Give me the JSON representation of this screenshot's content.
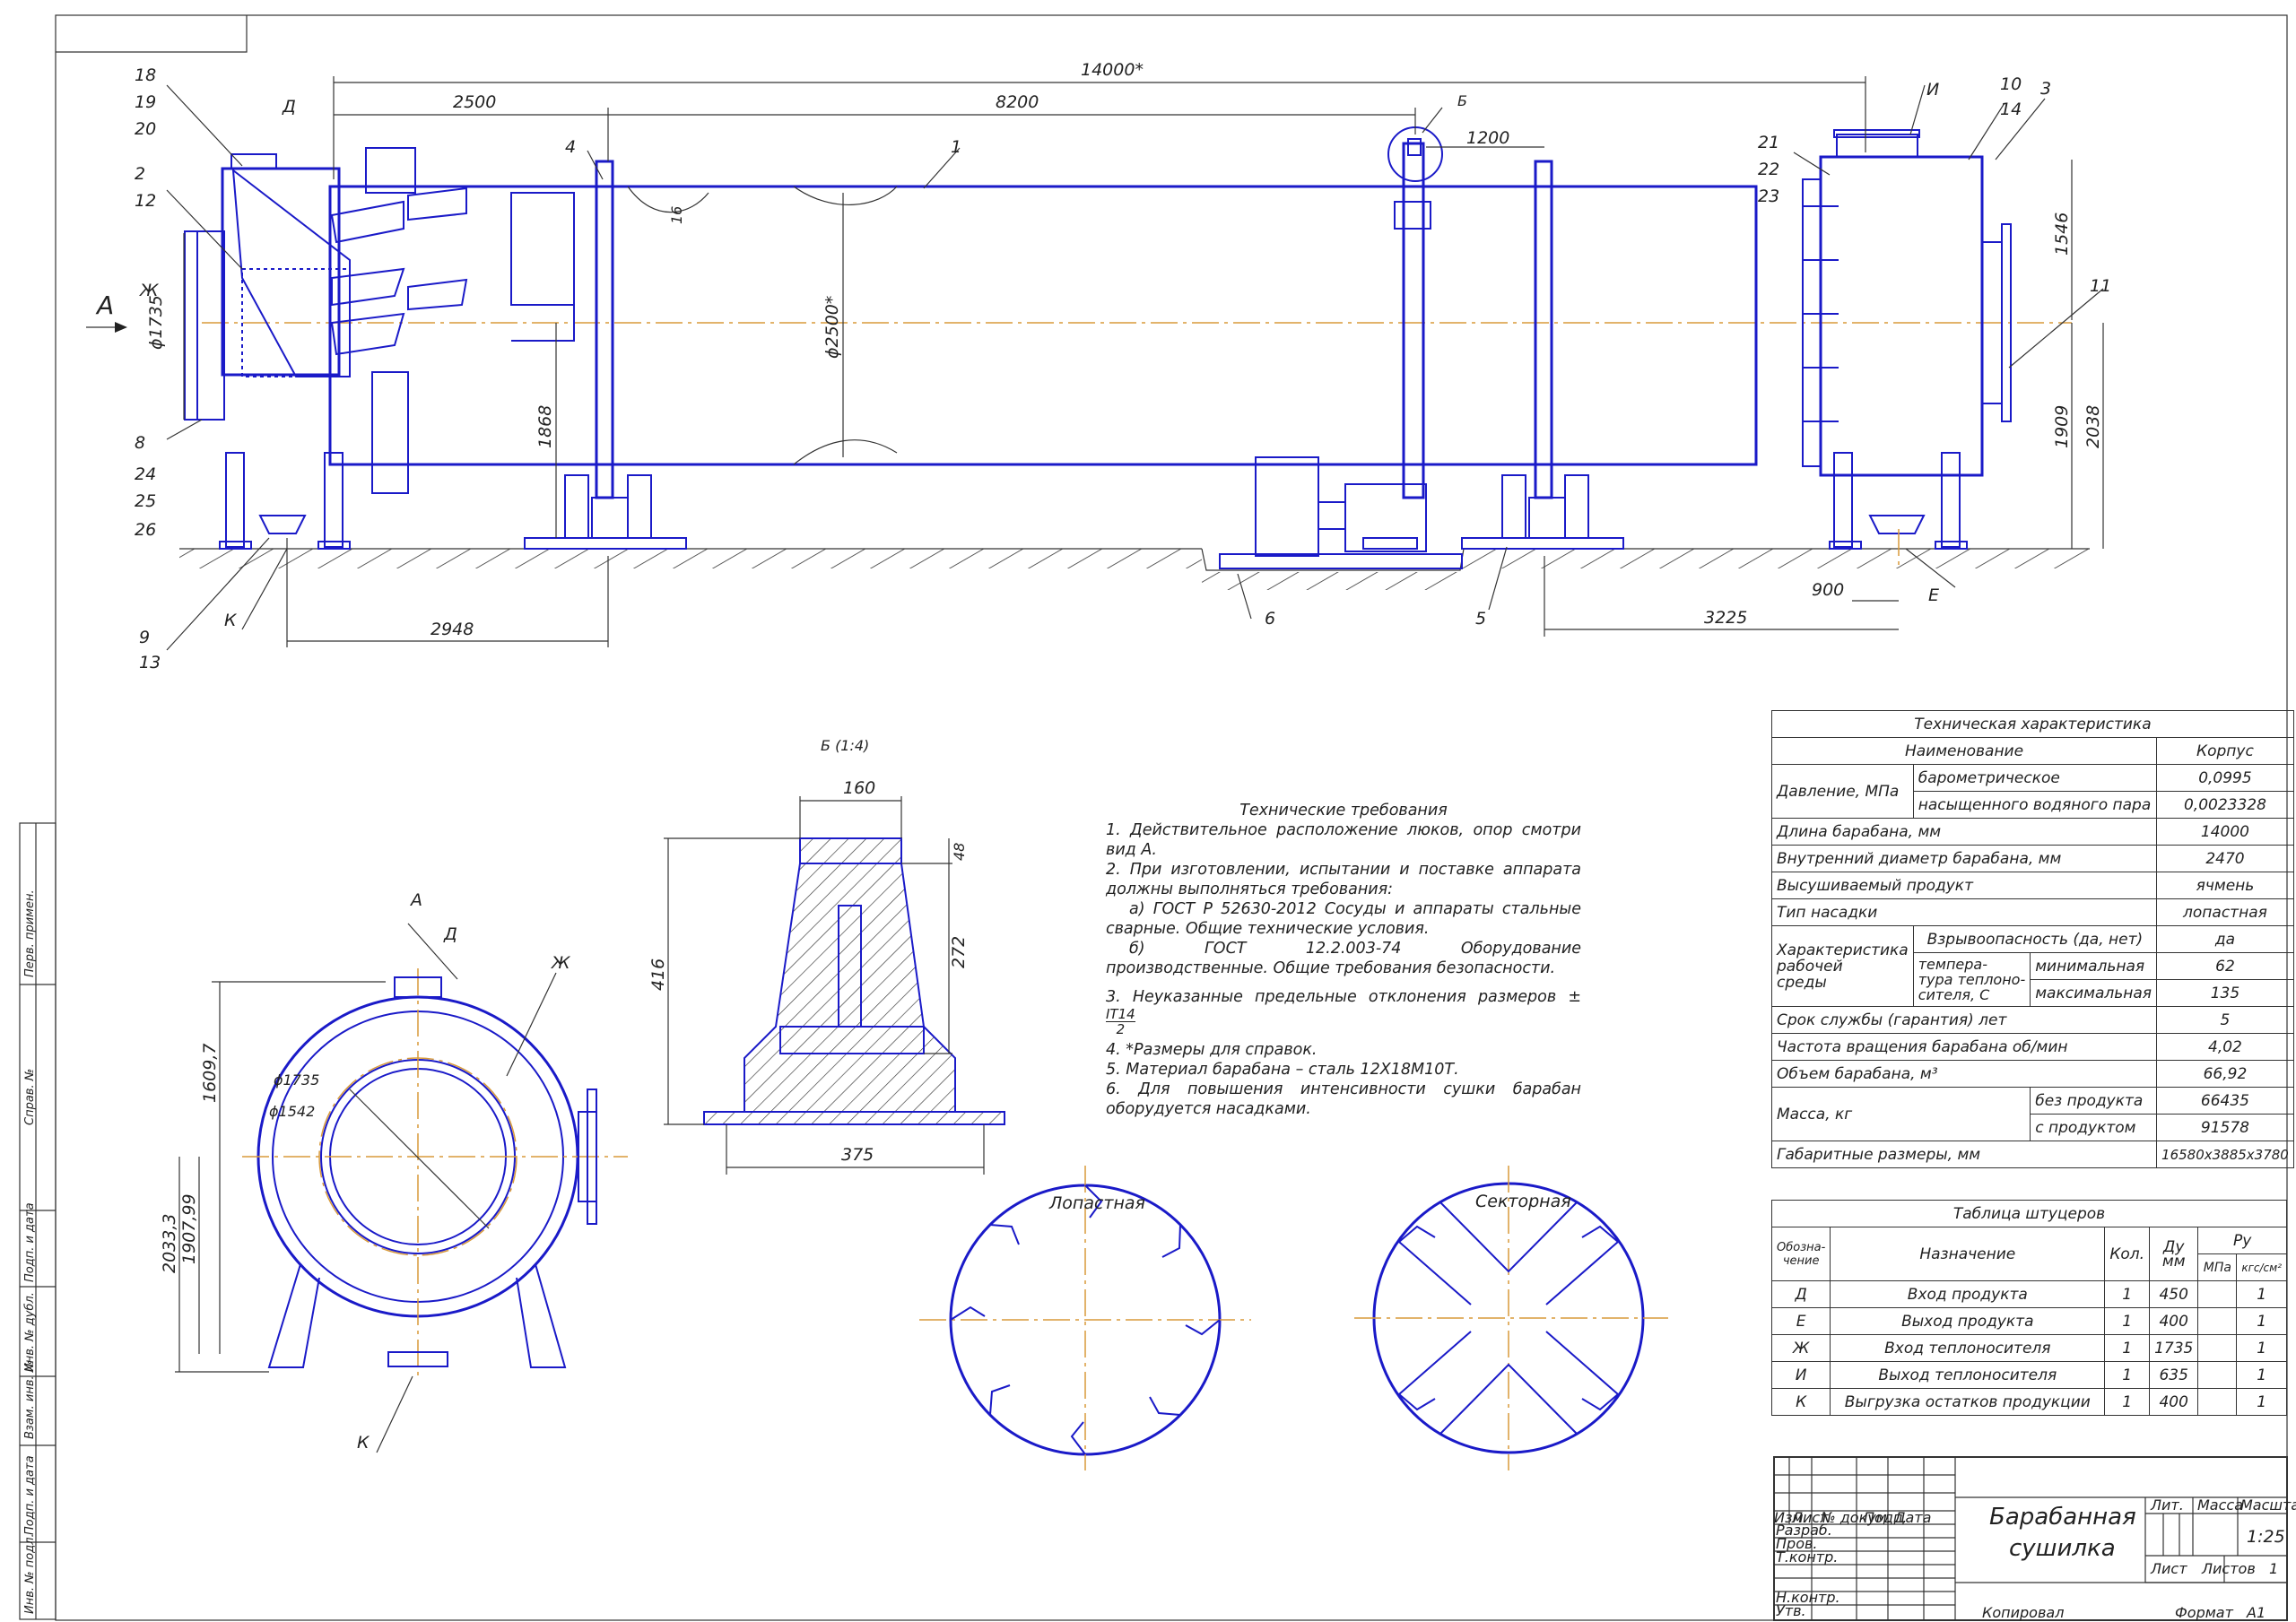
{
  "drawing": {
    "title_line1": "Барабанная",
    "title_line2": "сушилка",
    "scale": "1:25",
    "sheets": "1",
    "copied": "Копировал",
    "format_label": "Формат",
    "format": "A1",
    "lit_label": "Лит.",
    "mass_label": "Масса",
    "scale_label": "Масштаб",
    "sheet_label": "Лист",
    "sheets_label": "Листов",
    "stamp_rows": [
      "Изм.",
      "Лист",
      "№ докум.",
      "Подп.",
      "Дата"
    ],
    "stamp_roles": [
      "Разраб.",
      "Пров.",
      "Т.контр.",
      "Н.контр.",
      "Утв."
    ]
  },
  "side_labels": [
    "Перв. примен.",
    "Справ. №",
    "Подп. и дата",
    "Инв. № дубл.",
    "Взам. инв. №",
    "Подп. и дата",
    "Инв. № подл."
  ],
  "main_view": {
    "dims": {
      "total": "14000*",
      "d2500": "2500",
      "d8200": "8200",
      "d1200": "1200",
      "d2948": "2948",
      "d3225": "3225",
      "d900": "900",
      "d1546": "1546",
      "d1909": "1909",
      "d2038": "2038",
      "d1868": "1868",
      "dia2500": "ϕ2500*",
      "dia1735": "ϕ1735",
      "d16": "16"
    },
    "positions": [
      "18",
      "19",
      "20",
      "2",
      "12",
      "8",
      "24",
      "25",
      "26",
      "9",
      "13",
      "4",
      "1",
      "Б",
      "21",
      "22",
      "23",
      "10",
      "14",
      "3",
      "11",
      "6",
      "5",
      "Е",
      "К",
      "Д",
      "Ж",
      "И"
    ],
    "view_arrow": "А"
  },
  "view_a": {
    "label": "А",
    "dims": {
      "h1": "1609,7",
      "h2": "2033,3",
      "h3": "1907,99",
      "d1": "ϕ1735",
      "d2": "ϕ1542"
    },
    "letters": [
      "Д",
      "Ж",
      "К"
    ]
  },
  "view_b": {
    "label": "Б (1:4)",
    "dims": {
      "w_top": "160",
      "w_bottom": "375",
      "h_total": "416",
      "h_top": "48",
      "h_mid": "272"
    }
  },
  "requirements": {
    "title": "Технические требования",
    "items": [
      "1. Действительное расположение люков, опор смотри вид А.",
      "2. При изготовлении, испытании и поставке аппарата должны выполняться требования:",
      "а) ГОСТ Р 52630-2012 Сосуды и аппараты стальные сварные. Общие технические условия.",
      "б) ГОСТ 12.2.003-74 Оборудование производственные. Общие требования безопасности.",
      "3. Неуказанные предельные отклонения размеров ±",
      "4. *Размеры для справок.",
      "5. Материал барабана – сталь 12Х18М10Т.",
      "6. Для повышения интенсивности сушки барабан оборудуется насадками."
    ],
    "tol_num": "IT14",
    "tol_den": "2"
  },
  "nozzle_types": {
    "left": "Лопастная",
    "right": "Секторная"
  },
  "tech_table": {
    "title": "Техническая характеристика",
    "col_name": "Наименование",
    "col_val": "Корпус",
    "rows": {
      "pressure": "Давление, МПа",
      "p_bar": "барометрическое",
      "p_bar_v": "0,0995",
      "p_vap": "насыщенного водяного пара",
      "p_vap_v": "0,0023328",
      "length": "Длина барабана, мм",
      "length_v": "14000",
      "diam": "Внутренний диаметр барабана, мм",
      "diam_v": "2470",
      "product": "Высушиваемый продукт",
      "product_v": "ячмень",
      "nozzle": "Тип насадки",
      "nozzle_v": "лопастная",
      "char1": "Характеристика",
      "char2": "рабочей",
      "char3": "среды",
      "explos": "Взрывоопасность (да, нет)",
      "explos_v": "да",
      "temp1": "темпера-",
      "temp2": "тура теплоно-",
      "temp3": "сителя, С",
      "tmin": "минимальная",
      "tmin_v": "62",
      "tmax": "максимальная",
      "tmax_v": "135",
      "life": "Срок службы (гарантия) лет",
      "life_v": "5",
      "freq": "Частота вращения барабана об/мин",
      "freq_v": "4,02",
      "volume": "Объем барабана, м³",
      "volume_v": "66,92",
      "mass": "Масса, кг",
      "m_empty": "без продукта",
      "m_empty_v": "66435",
      "m_full": "с продуктом",
      "m_full_v": "91578",
      "overall": "Габаритные размеры, мм",
      "overall_v": "16580х3885х3780"
    }
  },
  "nozzle_table": {
    "title": "Таблица штуцеров",
    "h_mark1": "Обозна-",
    "h_mark2": "чение",
    "h_purpose": "Назначение",
    "h_qty": "Кол.",
    "h_du1": "Ду",
    "h_du2": "мм",
    "h_py": "Ру",
    "h_mpa": "МПа",
    "h_kgs": "кгс/см²",
    "rows": [
      {
        "mark": "Д",
        "purpose": "Вход продукта",
        "qty": "1",
        "du": "450",
        "py": "1"
      },
      {
        "mark": "Е",
        "purpose": "Выход продукта",
        "qty": "1",
        "du": "400",
        "py": "1"
      },
      {
        "mark": "Ж",
        "purpose": "Вход теплоносителя",
        "qty": "1",
        "du": "1735",
        "py": "1"
      },
      {
        "mark": "И",
        "purpose": "Выход теплоносителя",
        "qty": "1",
        "du": "635",
        "py": "1"
      },
      {
        "mark": "К",
        "purpose": "Выгрузка остатков продукции",
        "qty": "1",
        "du": "400",
        "py": "1"
      }
    ]
  }
}
